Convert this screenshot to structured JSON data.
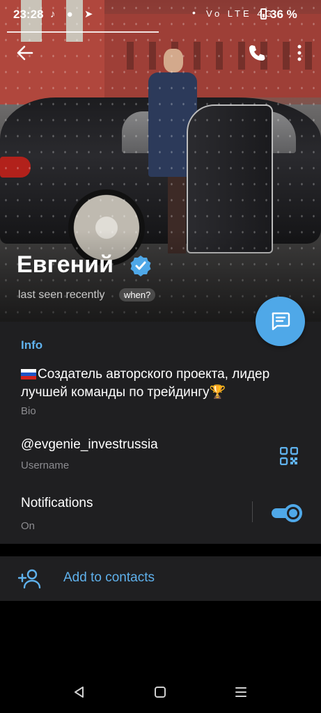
{
  "status_bar": {
    "time": "23:28",
    "battery": "36 %",
    "signal_text": "Vo LTE 4G"
  },
  "profile": {
    "name": "Евгений",
    "last_seen": "last seen recently",
    "when_link": "when?"
  },
  "info": {
    "section_title": "Info",
    "bio_text": "Создатель авторского проекта, лидер лучшей команды по трейдингу",
    "bio_label": "Bio",
    "username": "@evgenie_investrussia",
    "username_label": "Username",
    "notifications_title": "Notifications",
    "notifications_value": "On",
    "notifications_enabled": true
  },
  "actions": {
    "add_to_contacts": "Add to contacts"
  },
  "colors": {
    "accent": "#5fb1ec",
    "fab": "#4fa8e8",
    "panel": "#1f1f21",
    "muted": "#8c8c90"
  },
  "icons": [
    "back-arrow-icon",
    "phone-icon",
    "more-vertical-icon",
    "verified-badge-icon",
    "message-icon",
    "qr-code-icon",
    "add-person-icon",
    "nav-back-icon",
    "nav-home-icon",
    "nav-menu-icon"
  ]
}
